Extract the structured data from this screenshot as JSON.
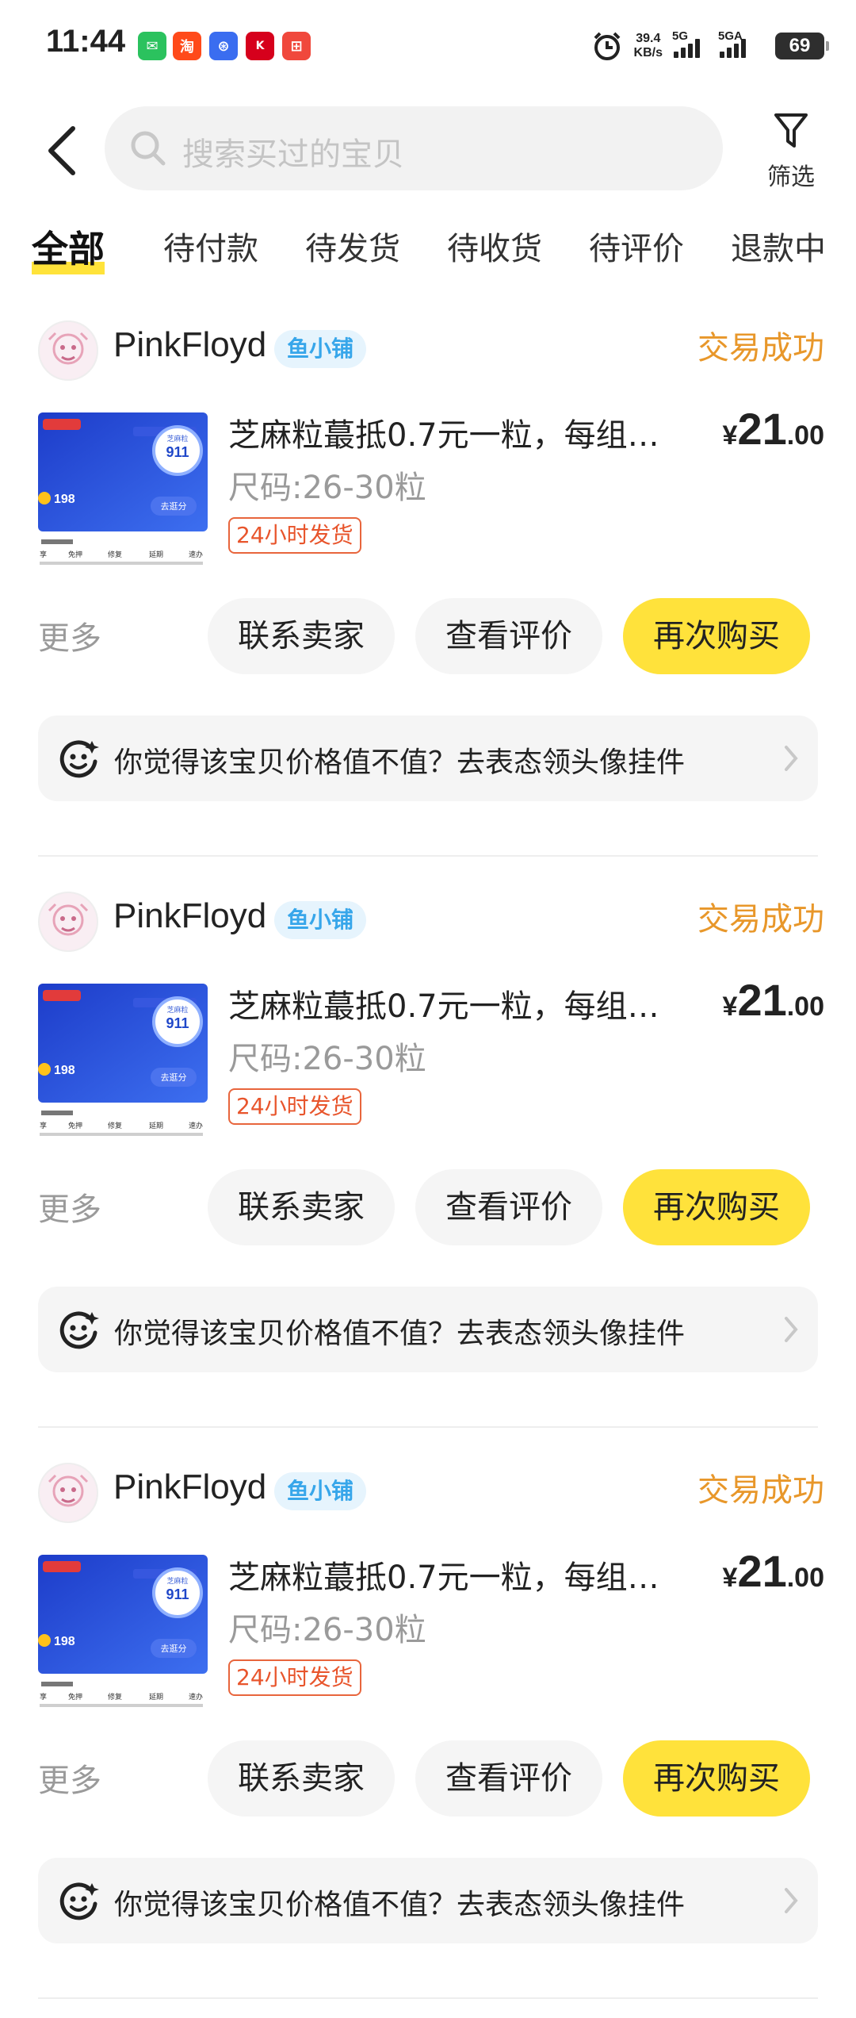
{
  "status_bar": {
    "time": "11:44",
    "net_speed_value": "39.4",
    "net_speed_unit": "KB/s",
    "signal1_label": "5G",
    "signal2_label": "5GA",
    "battery": "69",
    "apps": [
      {
        "name": "wechat-icon",
        "color": "#2bc25e",
        "glyph": "✉"
      },
      {
        "name": "taobao-icon",
        "color": "#ff4a1a",
        "glyph": "淘"
      },
      {
        "name": "baidu-icon",
        "color": "#3a6df0",
        "glyph": "⊛"
      },
      {
        "name": "kfc-icon",
        "color": "#d6001c",
        "glyph": "K"
      },
      {
        "name": "calendar-app-icon",
        "color": "#f0483c",
        "glyph": "⊞"
      }
    ]
  },
  "header": {
    "search_placeholder": "搜索买过的宝贝",
    "filter_label": "筛选"
  },
  "tabs": [
    "全部",
    "待付款",
    "待发货",
    "待收货",
    "待评价",
    "退款中"
  ],
  "orders": [
    {
      "shop_name": "PinkFloyd",
      "shop_badge": "鱼小铺",
      "status": "交易成功",
      "product_title": "芝麻粒蕞抵0.7元一粒，每组…",
      "product_spec": "尺码:26-30粒",
      "product_tag": "24小时发货",
      "price_currency": "¥",
      "price_int": "21",
      "price_dec": ".00",
      "more_label": "更多",
      "buttons": {
        "contact": "联系卖家",
        "review": "查看评价",
        "rebuy": "再次购买"
      },
      "prompt": "你觉得该宝贝价格值不值？去表态领头像挂件"
    },
    {
      "shop_name": "PinkFloyd",
      "shop_badge": "鱼小铺",
      "status": "交易成功",
      "product_title": "芝麻粒蕞抵0.7元一粒，每组…",
      "product_spec": "尺码:26-30粒",
      "product_tag": "24小时发货",
      "price_currency": "¥",
      "price_int": "21",
      "price_dec": ".00",
      "more_label": "更多",
      "buttons": {
        "contact": "联系卖家",
        "review": "查看评价",
        "rebuy": "再次购买"
      },
      "prompt": "你觉得该宝贝价格值不值？去表态领头像挂件"
    },
    {
      "shop_name": "PinkFloyd",
      "shop_badge": "鱼小铺",
      "status": "交易成功",
      "product_title": "芝麻粒蕞抵0.7元一粒，每组…",
      "product_spec": "尺码:26-30粒",
      "product_tag": "24小时发货",
      "price_currency": "¥",
      "price_int": "21",
      "price_dec": ".00",
      "more_label": "更多",
      "buttons": {
        "contact": "联系卖家",
        "review": "查看评价",
        "rebuy": "再次购买"
      },
      "prompt": "你觉得该宝贝价格值不值？去表态领头像挂件"
    }
  ],
  "thumb": {
    "score": "911",
    "score_label": "芝麻粒",
    "coins": "198",
    "chip": "去逛分",
    "row_labels": [
      "享",
      "免押",
      "修复",
      "延期",
      "速办"
    ]
  },
  "colors": {
    "accent_yellow": "#ffe23b",
    "status_orange": "#e8972a",
    "tag_red": "#e8552c",
    "badge_blue": "#37a6ea"
  }
}
